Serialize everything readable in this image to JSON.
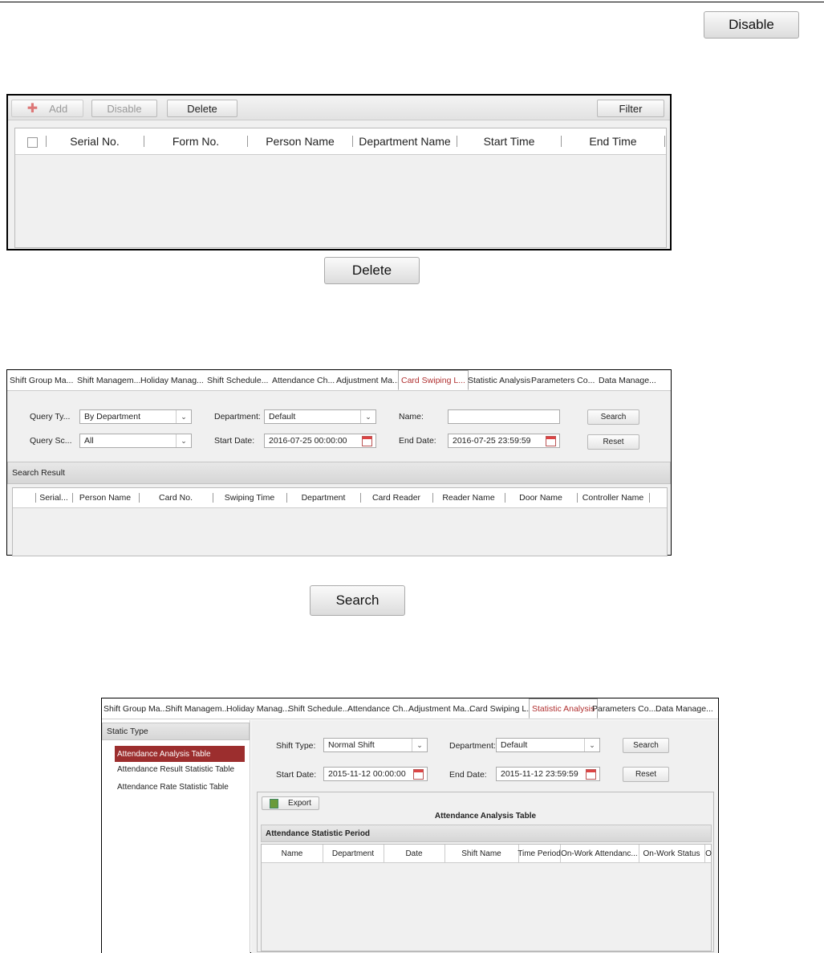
{
  "big_buttons": {
    "disable": "Disable",
    "delete": "Delete",
    "search": "Search"
  },
  "shot1": {
    "toolbar": {
      "add": "Add",
      "disable": "Disable",
      "delete": "Delete",
      "filter": "Filter"
    },
    "columns": [
      "Serial No.",
      "Form No.",
      "Person Name",
      "Department Name",
      "Start Time",
      "End Time"
    ]
  },
  "shot2": {
    "tabs": [
      "Shift Group Ma...",
      "Shift Managem...",
      "Holiday Manag...",
      "Shift Schedule...",
      "Attendance Ch...",
      "Adjustment Ma...",
      "Card Swiping L...",
      "Statistic Analysis",
      "Parameters Co...",
      "Data Manage..."
    ],
    "active_tab": "Card Swiping L...",
    "query_type_label": "Query Ty...",
    "query_type_value": "By Department",
    "query_scope_label": "Query Sc...",
    "query_scope_value": "All",
    "department_label": "Department:",
    "department_value": "Default",
    "name_label": "Name:",
    "name_value": "",
    "start_date_label": "Start Date:",
    "start_date_value": "2016-07-25 00:00:00",
    "end_date_label": "End Date:",
    "end_date_value": "2016-07-25 23:59:59",
    "search": "Search",
    "reset": "Reset",
    "result_header": "Search Result",
    "columns": [
      "Serial...",
      "Person Name",
      "Card No.",
      "Swiping Time",
      "Department",
      "Card Reader",
      "Reader Name",
      "Door Name",
      "Controller Name"
    ]
  },
  "shot3": {
    "tabs": [
      "Shift Group Ma...",
      "Shift Managem...",
      "Holiday Manag...",
      "Shift Schedule...",
      "Attendance Ch...",
      "Adjustment Ma...",
      "Card Swiping L...",
      "Statistic Analysis",
      "Parameters Co...",
      "Data Manage..."
    ],
    "active_tab": "Statistic Analysis",
    "side_header": "Static Type",
    "side_items": [
      "Attendance Analysis Table",
      "Attendance Result Statistic Table",
      "Attendance Rate Statistic Table"
    ],
    "shift_type_label": "Shift Type:",
    "shift_type_value": "Normal Shift",
    "department_label": "Department:",
    "department_value": "Default",
    "start_date_label": "Start Date:",
    "start_date_value": "2015-11-12 00:00:00",
    "end_date_label": "End Date:",
    "end_date_value": "2015-11-12 23:59:59",
    "search": "Search",
    "reset": "Reset",
    "export": "Export",
    "table_title": "Attendance Analysis Table",
    "period_header": "Attendance Statistic Period",
    "columns": [
      "Name",
      "Department",
      "Date",
      "Shift Name",
      "Time Period",
      "On-Work",
      "Attendanc...",
      "On-Work Status",
      "O"
    ]
  },
  "colors": {
    "active_tab": "#b03030",
    "selected_item": "#9c2e2e"
  },
  "icons": [
    "add-icon",
    "calendar-icon",
    "chevron-down-icon",
    "export-icon"
  ]
}
